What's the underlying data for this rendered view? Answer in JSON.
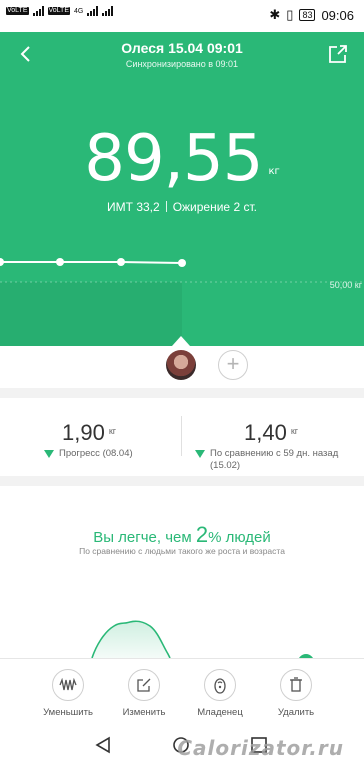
{
  "status_bar": {
    "carrier_chips": [
      "VoLTE",
      "VoLTE"
    ],
    "network": "4G",
    "time": "09:06",
    "battery": "83"
  },
  "header": {
    "title": "Олеся 15.04 09:01",
    "subtitle": "Синхронизировано в 09:01"
  },
  "measurement": {
    "weight": "89,55",
    "unit": "кг",
    "bmi": "ИМТ 33,2",
    "category": "Ожирение 2 ст.",
    "reference_label": "50,00 кг"
  },
  "stats": {
    "progress": {
      "value": "1,90",
      "unit": "кг",
      "label": "Прогресс (08.04)"
    },
    "comparison": {
      "value": "1,40",
      "unit": "кг",
      "label_line1": "По сравнению с 59 дн. назад",
      "label_line2": "(15.02)"
    }
  },
  "compare": {
    "title_prefix": "Вы легче, чем",
    "percent": "2",
    "title_suffix": "% людей",
    "subtitle": "По сравнению с людьми такого же роста и возраста"
  },
  "toolbar": {
    "items": [
      {
        "label": "Уменьшить",
        "icon": "waveform-icon"
      },
      {
        "label": "Изменить",
        "icon": "edit-icon"
      },
      {
        "label": "Младенец",
        "icon": "baby-icon"
      },
      {
        "label": "Удалить",
        "icon": "trash-icon"
      }
    ]
  },
  "watermark": "Calorizator.ru",
  "colors": {
    "accent": "#2ab877"
  }
}
